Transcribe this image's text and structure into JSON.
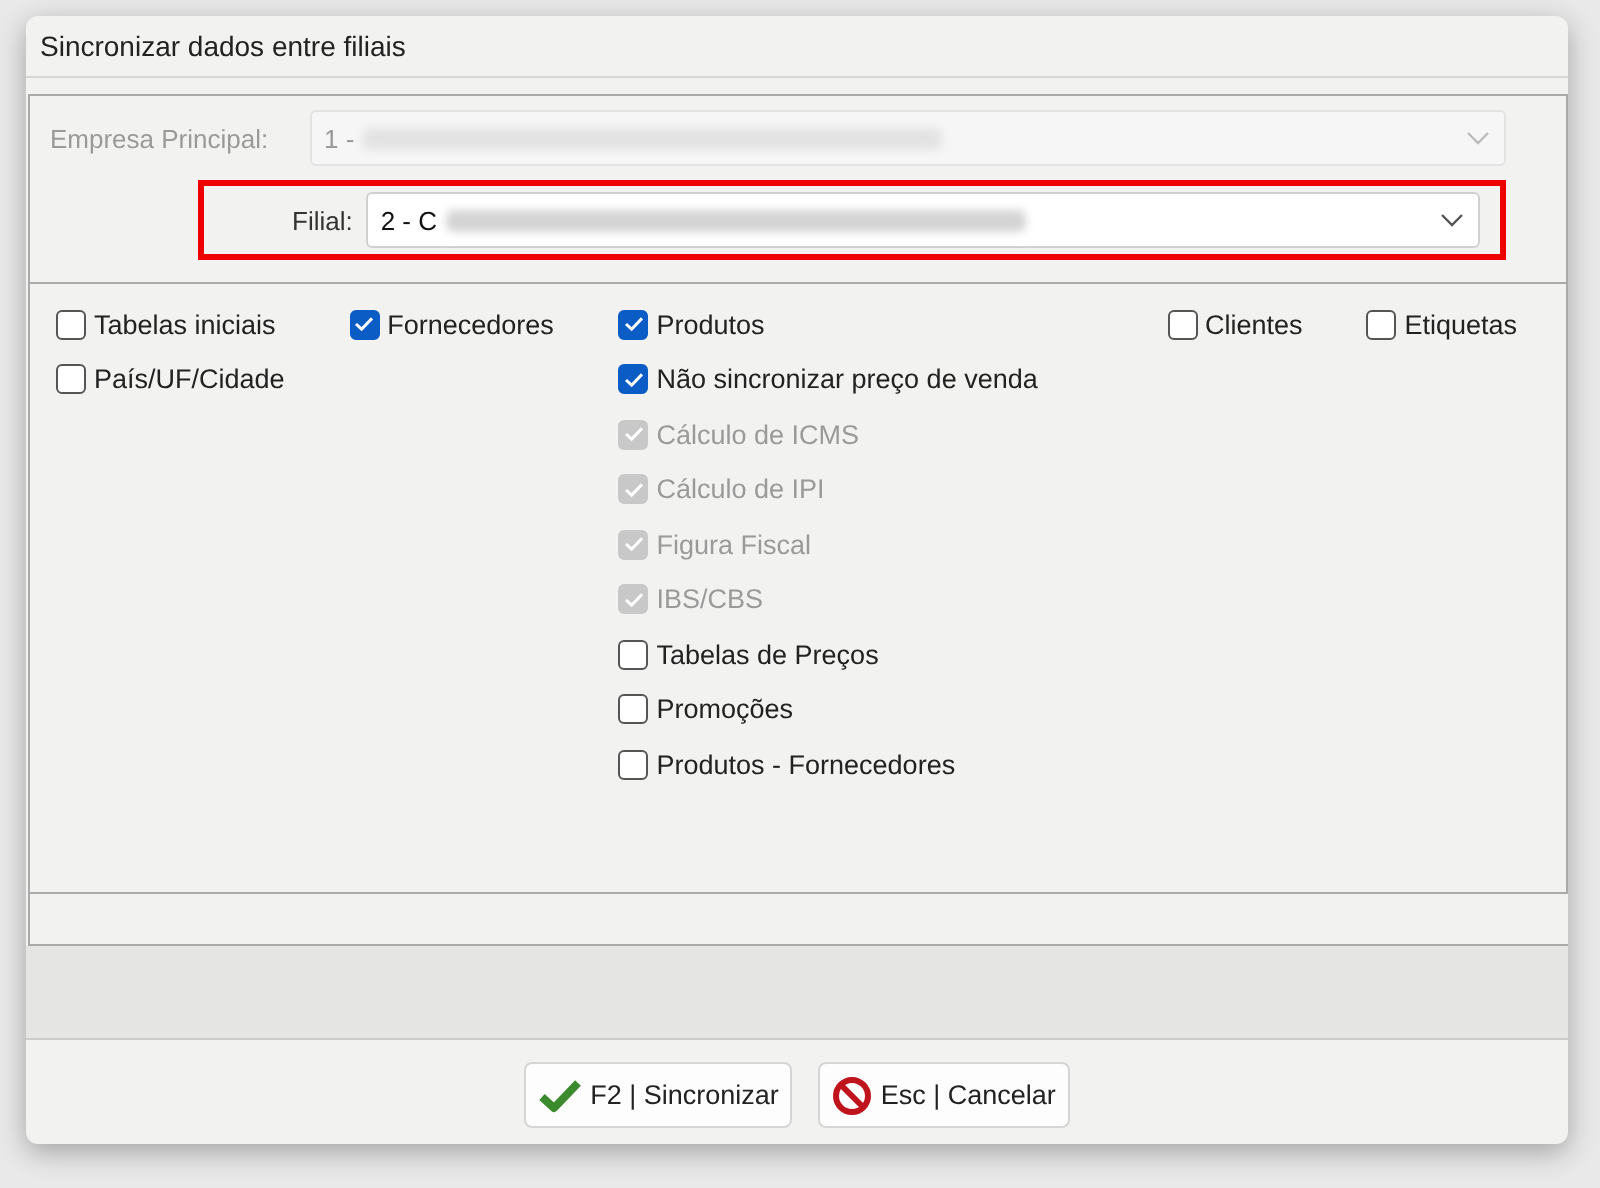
{
  "window": {
    "title": "Sincronizar dados entre filiais"
  },
  "empresa_principal": {
    "label": "Empresa Principal:",
    "value": "1 -",
    "disabled": true,
    "redacted": true
  },
  "filial": {
    "label": "Filial:",
    "value": "2 - C",
    "disabled": false,
    "redacted": true,
    "highlighted": true
  },
  "option_columns": [
    [
      {
        "label": "Tabelas iniciais",
        "checked": false,
        "disabled": false
      },
      {
        "label": "País/UF/Cidade",
        "checked": false,
        "disabled": false
      }
    ],
    [
      {
        "label": "Fornecedores",
        "checked": true,
        "disabled": false
      }
    ],
    [
      {
        "label": "Produtos",
        "checked": true,
        "disabled": false
      },
      {
        "label": "Não sincronizar preço de venda",
        "checked": true,
        "disabled": false
      },
      {
        "label": "Cálculo de ICMS",
        "checked": true,
        "disabled": true
      },
      {
        "label": "Cálculo de IPI",
        "checked": true,
        "disabled": true
      },
      {
        "label": "Figura Fiscal",
        "checked": true,
        "disabled": true
      },
      {
        "label": "IBS/CBS",
        "checked": true,
        "disabled": true
      },
      {
        "label": "Tabelas de Preços",
        "checked": false,
        "disabled": false
      },
      {
        "label": "Promoções",
        "checked": false,
        "disabled": false
      },
      {
        "label": "Produtos - Fornecedores",
        "checked": false,
        "disabled": false
      }
    ],
    [
      {
        "label": "Clientes",
        "checked": false,
        "disabled": false
      }
    ],
    [
      {
        "label": "Etiquetas",
        "checked": false,
        "disabled": false
      }
    ]
  ],
  "buttons": [
    {
      "label": "F2 | Sincronizar",
      "kind": "confirm"
    },
    {
      "label": "Esc | Cancelar",
      "kind": "cancel"
    }
  ]
}
